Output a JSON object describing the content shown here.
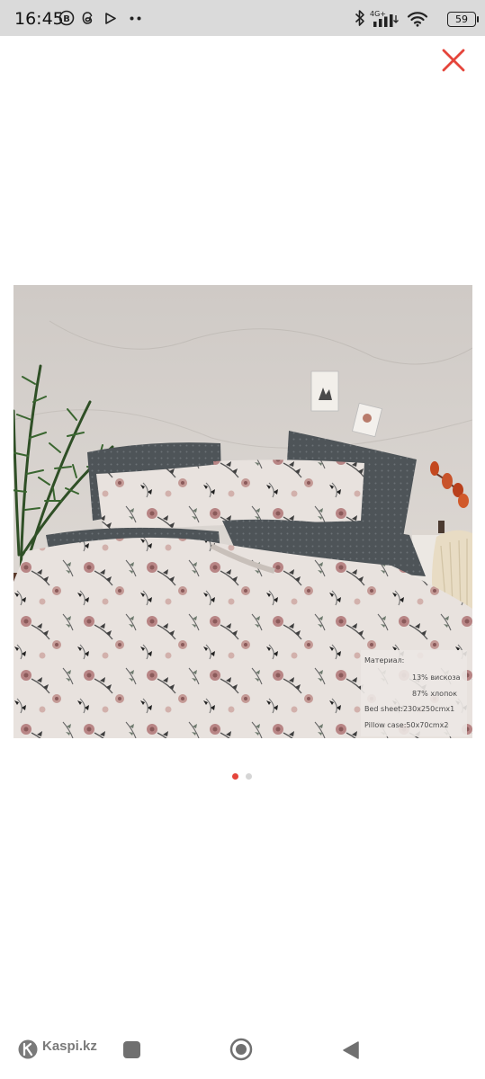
{
  "status_bar": {
    "time": "16:45",
    "network": "4G+",
    "battery_level": "59"
  },
  "close_icon_color": "#e5453b",
  "product_image": {
    "label_lines": [
      "Материал:",
      "13% вискоза",
      "87% хлопок",
      "Bed sheet:230x250cmx1",
      "Pillow case:50x70cmx2"
    ]
  },
  "pagination": {
    "total": 2,
    "active": 1,
    "active_color": "#e5453b",
    "inactive_color": "#d5d5d5"
  },
  "nav_bar": {
    "brand": "Kaspi.kz"
  }
}
